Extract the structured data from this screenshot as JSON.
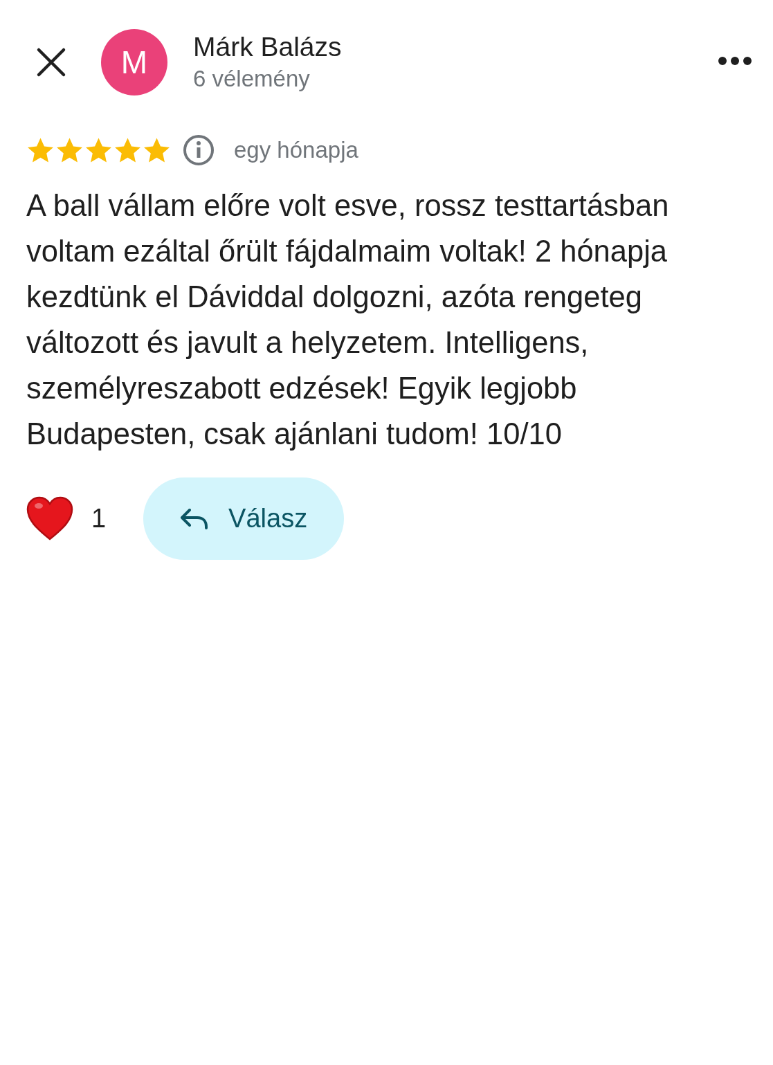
{
  "header": {
    "avatar_letter": "M",
    "name": "Márk Balázs",
    "review_count": "6 vélemény"
  },
  "review": {
    "stars": 5,
    "time": "egy hónapja",
    "text": "A ball vállam előre volt esve, rossz testtartásban voltam ezáltal őrült fájdalmaim voltak! 2 hónapja kezdtünk el Dáviddal dolgozni, azóta rengeteg változott és javult a helyzetem. Intelligens, személyreszabott edzések! Egyik legjobb Budapesten, csak ajánlani tudom! 10/10"
  },
  "actions": {
    "liked": true,
    "like_count": "1",
    "reply_label": "Válasz"
  }
}
